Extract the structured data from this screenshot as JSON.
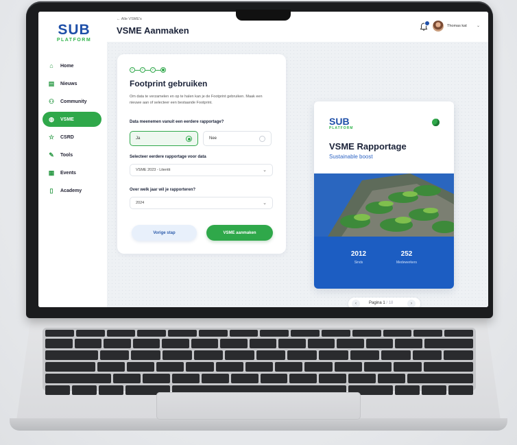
{
  "app": {
    "logo_main": "SUB",
    "logo_sub": "PLATFORM"
  },
  "sidebar": {
    "items": [
      {
        "label": "Home",
        "icon": "home-icon"
      },
      {
        "label": "Nieuws",
        "icon": "news-icon"
      },
      {
        "label": "Community",
        "icon": "community-icon"
      },
      {
        "label": "VSME",
        "icon": "vsme-icon",
        "active": true
      },
      {
        "label": "CSRD",
        "icon": "star-icon"
      },
      {
        "label": "Tools",
        "icon": "tools-icon"
      },
      {
        "label": "Events",
        "icon": "calendar-icon"
      },
      {
        "label": "Academy",
        "icon": "book-icon"
      }
    ]
  },
  "header": {
    "breadcrumb": "← Alle VSME's",
    "title": "VSME Aanmaken",
    "user_name": "Thomas kat",
    "notification_icon": "bell-icon"
  },
  "wizard": {
    "steps_total": 4,
    "current_step": 4,
    "title": "Footprint gebruiken",
    "description": "Om data te verzamelen en op te halen kan je de Footprint gebruiken. Maak een nieuwe aan of selecteer een bestaande Footprint.",
    "question1": "Data meenemen vanuit een eerdere rapportage?",
    "option_yes": "Ja",
    "option_no": "Nee",
    "selected_option": "Ja",
    "question2": "Selecteer eerdere rapportage voor data",
    "select_report_value": "VSME 2023 - Litentti",
    "question3": "Over welk jaar wil je rapporteren?",
    "select_year_value": "2024",
    "prev_button": "Vorige stap",
    "next_button": "VSME aanmaken"
  },
  "preview": {
    "logo_main": "SUB",
    "logo_sub": "PLATFORM",
    "title": "VSME Rapportage",
    "subtitle": "Sustainable boost",
    "stat1_value": "2012",
    "stat1_label": "Sinds",
    "stat2_value": "252",
    "stat2_label": "Medewerkers"
  },
  "pager": {
    "label": "Pagina 1",
    "total": "/ 18"
  },
  "colors": {
    "brand_blue": "#1e4fa8",
    "brand_green": "#2fa84a"
  }
}
